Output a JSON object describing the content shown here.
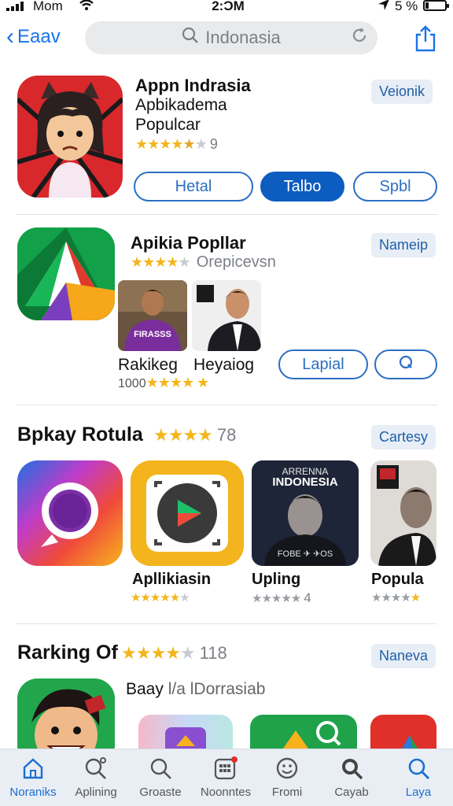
{
  "status_bar": {
    "carrier": "Mom",
    "time": "2:ƆM",
    "battery": "5 %"
  },
  "nav": {
    "back_label": "Eaav",
    "search_value": "Indonasia"
  },
  "section1": {
    "title": "Appn Indrasia",
    "subtitle1": "Apbikadema",
    "subtitle2": "Populcar",
    "rating_count": "9",
    "tag": "Veionik",
    "buttons": [
      "Hetal",
      "Talbo",
      "Spbl"
    ]
  },
  "section2": {
    "title": "Apikia Popllar",
    "rating_text": "Orepicevsn",
    "tag": "Nameip",
    "thumb1_name": "Rakikeg",
    "thumb1_meta": "1000",
    "thumb1_shirt": "FIRASSS",
    "thumb2_name": "Heyaiog",
    "button1": "Lapial"
  },
  "section3": {
    "title": "Bpkay Rotula",
    "rating_count": "78",
    "tag": "Cartesy",
    "cards": [
      {
        "name": "Apllikiasin",
        "count": ""
      },
      {
        "name": "Upling",
        "count": "4"
      },
      {
        "name": "Popula",
        "count": ""
      }
    ],
    "poster_line1": "ARRENNA",
    "poster_line2": "INDONESIA",
    "poster_footer": "FOBE ✈ ✈OS"
  },
  "section4": {
    "title": "Rarking Of",
    "rating_count": "118",
    "tag": "Naneva",
    "subtitle": "Baay",
    "subtitle_faded": "l/a lDorrasiab"
  },
  "tabbar": {
    "tabs": [
      {
        "label": "Noraniks",
        "icon": "home-icon"
      },
      {
        "label": "Aplining",
        "icon": "search-icon"
      },
      {
        "label": "Groaste",
        "icon": "search-icon"
      },
      {
        "label": "Noonntes",
        "icon": "apps-icon"
      },
      {
        "label": "Fromi",
        "icon": "smiley-icon"
      },
      {
        "label": "Cayab",
        "icon": "search-icon"
      },
      {
        "label": "Laya",
        "icon": "search-icon"
      }
    ]
  },
  "colors": {
    "accent": "#1a6fcf",
    "star": "#f2b61d",
    "tag_bg": "#e8eef6"
  }
}
